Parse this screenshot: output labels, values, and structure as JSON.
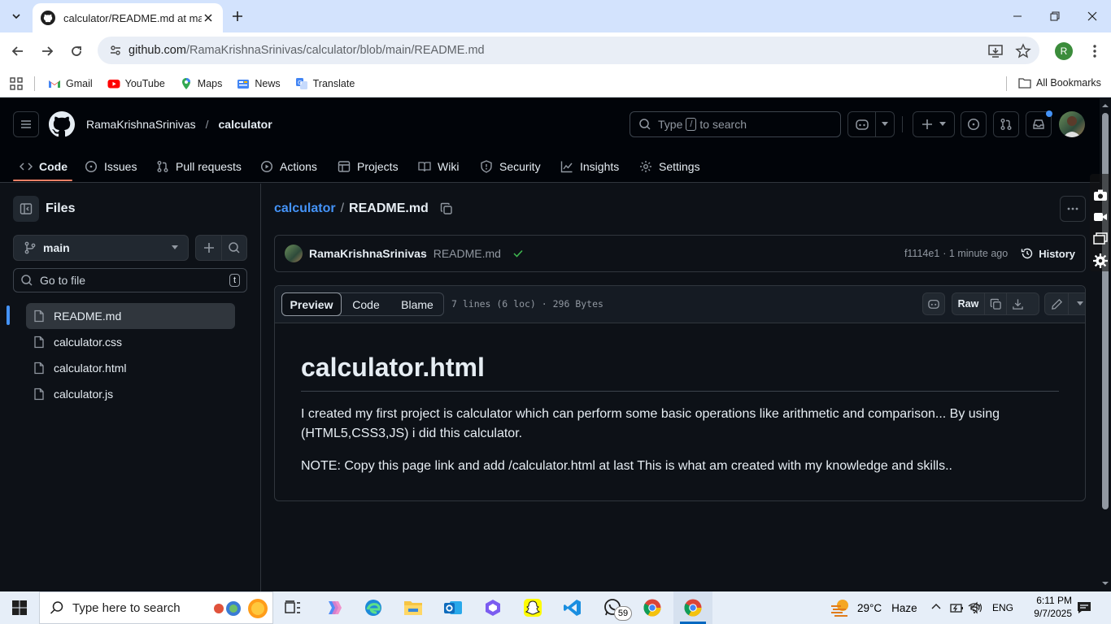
{
  "browser": {
    "tab_title": "calculator/README.md at main",
    "url_host": "github.com",
    "url_path": "/RamaKrishnaSrinivas/calculator/blob/main/README.md",
    "profile_initial": "R",
    "bookmarks": [
      {
        "label": "Gmail",
        "icon": "gmail-icon"
      },
      {
        "label": "YouTube",
        "icon": "youtube-icon"
      },
      {
        "label": "Maps",
        "icon": "maps-icon"
      },
      {
        "label": "News",
        "icon": "news-icon"
      },
      {
        "label": "Translate",
        "icon": "translate-icon"
      }
    ],
    "all_bookmarks": "All Bookmarks"
  },
  "github": {
    "owner": "RamaKrishnaSrinivas",
    "separator": "/",
    "repo": "calculator",
    "search_prefix": "Type",
    "search_key": "/",
    "search_suffix": "to search",
    "nav": [
      "Code",
      "Issues",
      "Pull requests",
      "Actions",
      "Projects",
      "Wiki",
      "Security",
      "Insights",
      "Settings"
    ],
    "files_title": "Files",
    "branch": "main",
    "go_to_file": "Go to file",
    "go_to_file_key": "t",
    "files": [
      "README.md",
      "calculator.css",
      "calculator.html",
      "calculator.js"
    ],
    "breadcrumb_repo": "calculator",
    "breadcrumb_sep": "/",
    "breadcrumb_file": "README.md",
    "commit": {
      "author": "RamaKrishnaSrinivas",
      "message": "README.md",
      "sha": "f1114e1",
      "time": "· 1 minute ago",
      "history": "History"
    },
    "view_tabs": [
      "Preview",
      "Code",
      "Blame"
    ],
    "file_meta": "7 lines (6 loc) · 296 Bytes",
    "raw_label": "Raw",
    "readme": {
      "heading": "calculator.html",
      "para1": "I created my first project is calculator which can perform some basic operations like arithmetic and comparison... By using (HTML5,CSS3,JS) i did this calculator.",
      "para2": "NOTE: Copy this page link and add /calculator.html at last This is what am created with my knowledge and skills.."
    }
  },
  "taskbar": {
    "search_placeholder": "Type here to search",
    "whatsapp_badge": "59",
    "weather_temp": "29°C",
    "weather_desc": "Haze",
    "lang": "ENG",
    "time": "6:11 PM",
    "date": "9/7/2025"
  },
  "colors": {
    "accent_blue": "#4493f8",
    "tab_underline": "#f78166",
    "gh_bg": "#0d1117",
    "chrome_frame": "#d3e3fd"
  }
}
